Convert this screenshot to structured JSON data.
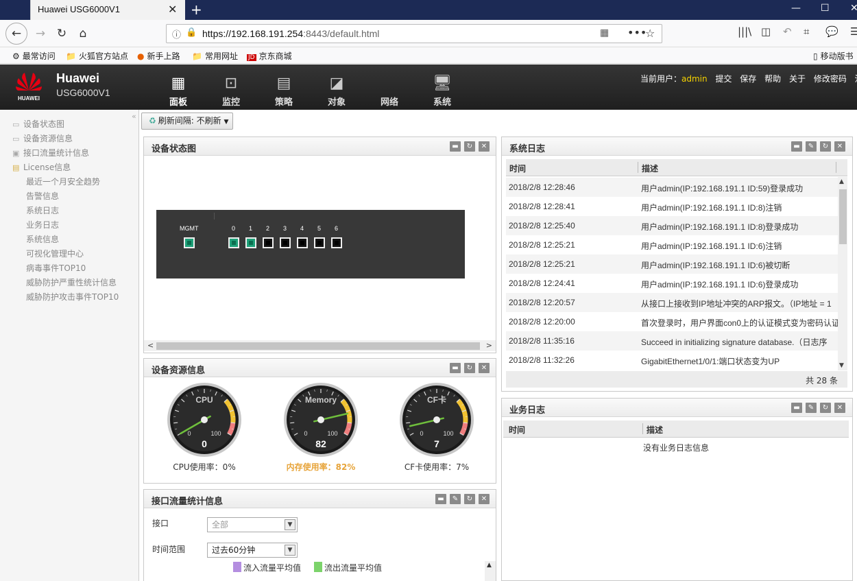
{
  "browser": {
    "tab_title": "Huawei USG6000V1",
    "url_host": "https://192.168.191.254",
    "url_rest": ":8443/default.html",
    "bookmarks": [
      "最常访问",
      "火狐官方站点",
      "新手上路",
      "常用网址",
      "京东商城",
      "移动版书"
    ]
  },
  "app": {
    "brand_name": "Huawei",
    "model": "USG6000V1",
    "logo_text": "HUAWEI",
    "menu": [
      {
        "label": "面板",
        "icon": "dashboard-icon",
        "active": true
      },
      {
        "label": "监控",
        "icon": "monitor-icon"
      },
      {
        "label": "策略",
        "icon": "policy-icon"
      },
      {
        "label": "对象",
        "icon": "object-icon"
      },
      {
        "label": "网络",
        "icon": "network-icon"
      },
      {
        "label": "系统",
        "icon": "system-icon"
      }
    ],
    "user": {
      "prefix": "当前用户：",
      "name": "admin",
      "links": [
        "提交",
        "保存",
        "帮助",
        "关于",
        "修改密码",
        "注销"
      ]
    }
  },
  "sidebar": {
    "items": [
      {
        "label": "设备状态图"
      },
      {
        "label": "设备资源信息"
      },
      {
        "label": "接口流量统计信息"
      },
      {
        "label": "License信息"
      },
      {
        "label": "最近一个月安全趋势"
      },
      {
        "label": "告警信息"
      },
      {
        "label": "系统日志"
      },
      {
        "label": "业务日志"
      },
      {
        "label": "系统信息"
      },
      {
        "label": "可视化管理中心"
      },
      {
        "label": "病毒事件TOP10"
      },
      {
        "label": "威胁防护严重性统计信息"
      },
      {
        "label": "威胁防护攻击事件TOP10"
      }
    ]
  },
  "toolbar": {
    "refresh_label": "刷新间隔: 不刷新"
  },
  "device_panel": {
    "title": "设备状态图",
    "mgmt_label": "MGMT",
    "ports": [
      {
        "label": "0",
        "status": "up"
      },
      {
        "label": "1",
        "status": "up"
      },
      {
        "label": "2",
        "status": "down"
      },
      {
        "label": "3",
        "status": "down"
      },
      {
        "label": "4",
        "status": "down"
      },
      {
        "label": "5",
        "status": "down"
      },
      {
        "label": "6",
        "status": "down"
      }
    ]
  },
  "resource_panel": {
    "title": "设备资源信息",
    "gauges": [
      {
        "name": "CPU",
        "value": 0,
        "caption": "CPU使用率：0%",
        "warn": false
      },
      {
        "name": "Memory",
        "value": 82,
        "caption": "内存使用率：82%",
        "warn": true
      },
      {
        "name": "CF卡",
        "value": 7,
        "caption": "CF卡使用率：7%",
        "warn": false
      }
    ],
    "scale_min": "0",
    "scale_max": "100"
  },
  "traffic_panel": {
    "title": "接口流量统计信息",
    "interface_label": "接口",
    "interface_value": "全部",
    "range_label": "时间范围",
    "range_value": "过去60分钟",
    "legend_in": "流入流量平均值",
    "legend_out": "流出流量平均值",
    "colors": {
      "in": "#b48ee0",
      "out": "#7cd36b"
    }
  },
  "syslog_panel": {
    "title": "系统日志",
    "col_time": "时间",
    "col_desc": "描述",
    "rows": [
      {
        "time": "2018/2/8 12:28:46",
        "desc": "用户admin(IP:192.168.191.1 ID:59)登录成功"
      },
      {
        "time": "2018/2/8 12:28:41",
        "desc": "用户admin(IP:192.168.191.1 ID:8)注销"
      },
      {
        "time": "2018/2/8 12:25:40",
        "desc": "用户admin(IP:192.168.191.1 ID:8)登录成功"
      },
      {
        "time": "2018/2/8 12:25:21",
        "desc": "用户admin(IP:192.168.191.1 ID:6)注销"
      },
      {
        "time": "2018/2/8 12:25:21",
        "desc": "用户admin(IP:192.168.191.1 ID:6)被切断"
      },
      {
        "time": "2018/2/8 12:24:41",
        "desc": "用户admin(IP:192.168.191.1 ID:6)登录成功"
      },
      {
        "time": "2018/2/8 12:20:57",
        "desc": "从接口上接收到IP地址冲突的ARP报文。（IP地址 = 1"
      },
      {
        "time": "2018/2/8 12:20:00",
        "desc": "首次登录时，用户界面con0上的认证模式变为密码认证"
      },
      {
        "time": "2018/2/8 11:35:16",
        "desc": "Succeed in initializing signature database.（日志序"
      },
      {
        "time": "2018/2/8 11:32:26",
        "desc": "GigabitEthernet1/0/1:端口状态变为UP"
      }
    ],
    "total": "共 28 条"
  },
  "svclog_panel": {
    "title": "业务日志",
    "col_time": "时间",
    "col_desc": "描述",
    "empty_text": "没有业务日志信息"
  }
}
